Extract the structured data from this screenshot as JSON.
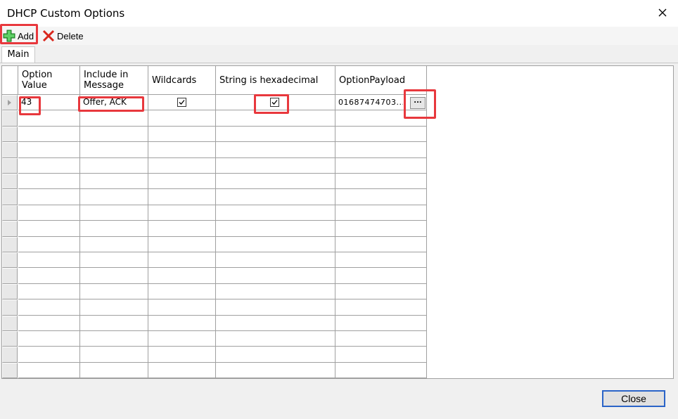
{
  "window": {
    "title": "DHCP Custom Options",
    "close_icon": "close-icon"
  },
  "toolbar": {
    "add_label": "Add",
    "delete_label": "Delete"
  },
  "tabs": [
    {
      "label": "Main"
    }
  ],
  "grid": {
    "columns": [
      {
        "label": "Option\nValue"
      },
      {
        "label": "Include in\nMessage"
      },
      {
        "label": "Wildcards"
      },
      {
        "label": "String is hexadecimal"
      },
      {
        "label": "OptionPayload"
      }
    ],
    "rows": [
      {
        "option_value": "43",
        "include_in_message": "Offer, ACK",
        "wildcards": true,
        "string_is_hex": true,
        "option_payload": "01687474703..."
      }
    ],
    "ellipsis_label": "..."
  },
  "footer": {
    "close_label": "Close"
  }
}
